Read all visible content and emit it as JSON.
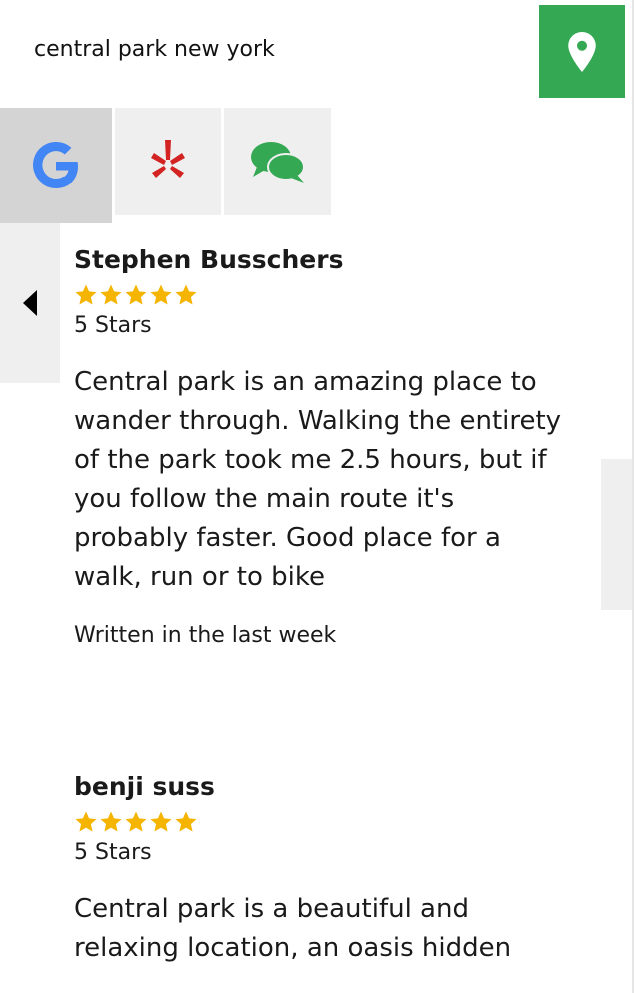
{
  "search": {
    "query": "central park new york"
  },
  "toolbar": {
    "locate_icon": "map-pin-icon"
  },
  "tabs": [
    {
      "name": "google",
      "icon": "google-g-icon",
      "active": true
    },
    {
      "name": "yelp",
      "icon": "yelp-burst-icon",
      "active": false
    },
    {
      "name": "chat",
      "icon": "chat-bubbles-icon",
      "active": false
    }
  ],
  "colors": {
    "accent_green": "#34a853",
    "star_gold": "#f4b400",
    "tab_bg": "#efefef",
    "tab_active_bg": "#d4d4d4",
    "yelp_red": "#d32323",
    "chat_green": "#34a853"
  },
  "reviews": [
    {
      "author": "Stephen Busschers",
      "rating": 5,
      "stars_label": "5 Stars",
      "text": "Central park is an amazing place to\nwander through. Walking the entirety\nof the park took me 2.5 hours, but if\nyou follow the main route it's\nprobably faster. Good place for a\nwalk, run or to bike",
      "date": "Written in the last week"
    },
    {
      "author": "benji suss",
      "rating": 5,
      "stars_label": "5 Stars",
      "text": "Central park is a beautiful and\nrelaxing location, an oasis hidden",
      "date": ""
    }
  ]
}
